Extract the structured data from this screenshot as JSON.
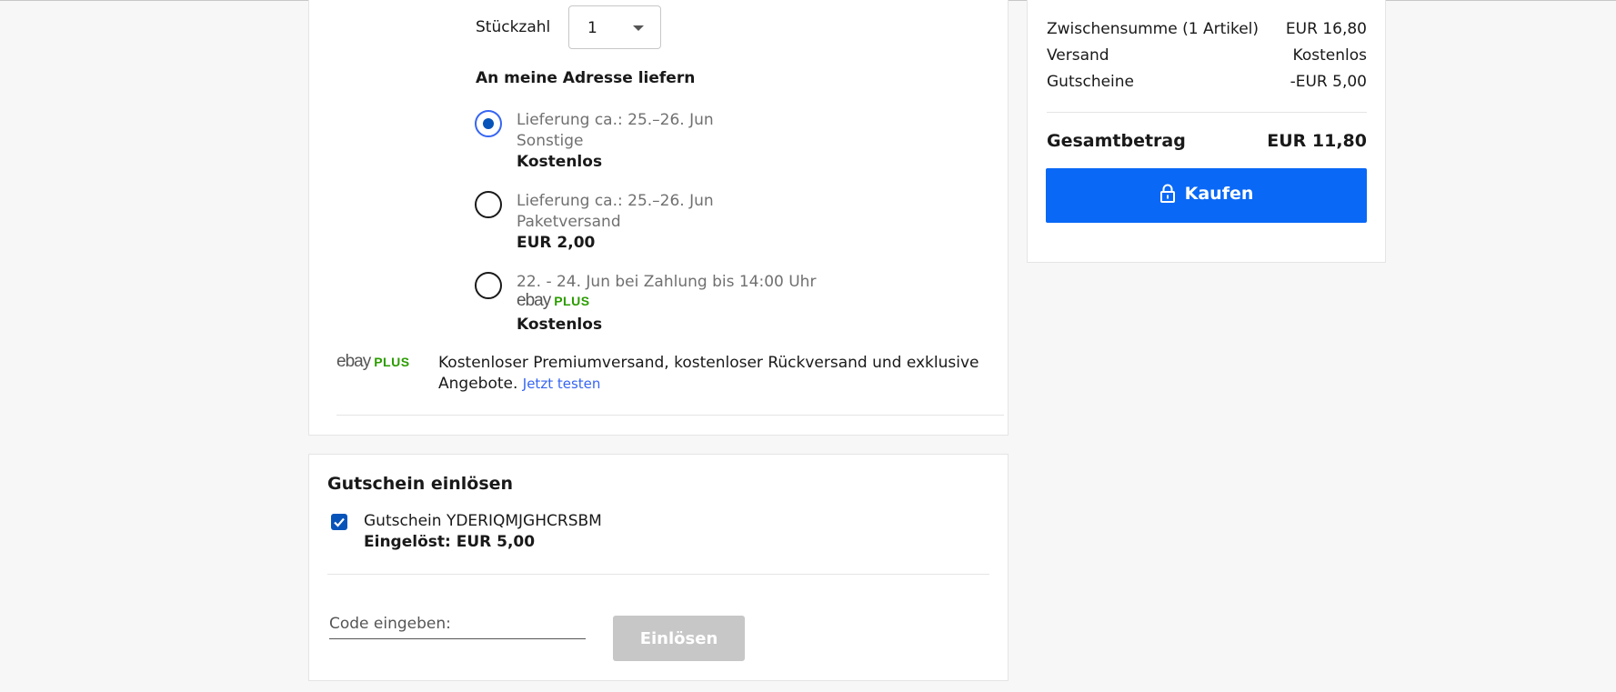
{
  "shipping": {
    "quantity_label": "Stückzahl",
    "quantity_value": "1",
    "deliver_heading": "An meine Adresse liefern",
    "options": [
      {
        "line1": "Lieferung ca.: 25.–26. Jun",
        "line2": "Sonstige",
        "price": "Kostenlos",
        "selected": true
      },
      {
        "line1": "Lieferung ca.: 25.–26. Jun",
        "line2": "Paketversand",
        "price": "EUR 2,00",
        "selected": false
      },
      {
        "line1": "22. - 24. Jun bei Zahlung bis 14:00 Uhr",
        "line2_logo_text": "ebay",
        "line2_plus_text": "PLUS",
        "price": "Kostenlos",
        "selected": false
      }
    ],
    "promo": {
      "logo_text": "ebay",
      "logo_plus": "PLUS",
      "text": "Kostenloser Premiumversand, kostenloser Rückversand und exklusive Angebote.",
      "link": "Jetzt testen"
    }
  },
  "coupon": {
    "title": "Gutschein einlösen",
    "checked": true,
    "name": "Gutschein YDERIQMJGHCRSBM",
    "redeemed": "Eingelöst: EUR 5,00",
    "code_placeholder": "Code eingeben:",
    "redeem_button": "Einlösen"
  },
  "summary": {
    "subtotal_label": "Zwischensumme (1 Artikel)",
    "subtotal_value": "EUR 16,80",
    "shipping_label": "Versand",
    "shipping_value": "Kostenlos",
    "coupons_label": "Gutscheine",
    "coupons_value": "-EUR 5,00",
    "total_label": "Gesamtbetrag",
    "total_value": "EUR 11,80",
    "buy_button": "Kaufen"
  },
  "colors": {
    "accent_blue": "#0968f6",
    "radio_selected": "#0654ba",
    "plus_green": "#2b9c00",
    "disabled_button": "#c7c7c7"
  },
  "icons": [
    "chevron-down-icon",
    "lock-icon",
    "checkmark-icon"
  ]
}
